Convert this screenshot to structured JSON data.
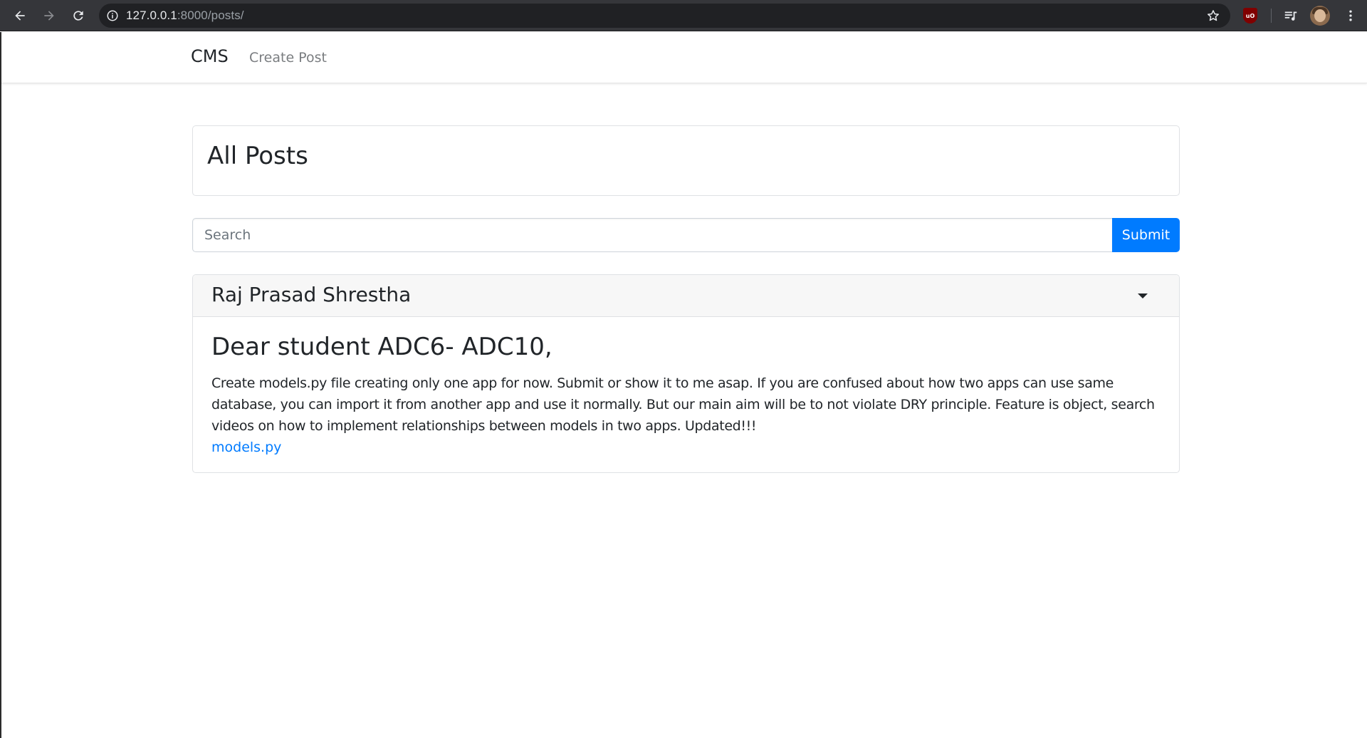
{
  "browser": {
    "url_host": "127.0.0.1",
    "url_path": ":8000/posts/",
    "icons": [
      "back-icon",
      "forward-icon",
      "reload-icon",
      "info-icon",
      "star-icon",
      "ublock-icon",
      "media-icon",
      "avatar",
      "menu-icon"
    ],
    "ublock_label": "uO"
  },
  "navbar": {
    "brand": "CMS",
    "links": [
      "Create Post"
    ]
  },
  "page": {
    "heading": "All Posts"
  },
  "search": {
    "placeholder": "Search",
    "value": "",
    "submit_label": "Submit"
  },
  "posts": [
    {
      "author": "Raj Prasad Shrestha",
      "title": "Dear student ADC6- ADC10,",
      "body": "Create models.py file creating only one app for now. Submit or show it to me asap. If you are confused about how two apps can use same database, you can import it from another app and use it normally. But our main aim will be to not violate DRY principle. Feature is object, search videos on how to implement relationships between models in two apps. Updated!!!",
      "attachment": "models.py"
    }
  ],
  "colors": {
    "primary": "#007bff",
    "chrome_bg": "#35363a",
    "omnibox_bg": "#202124",
    "card_header_bg": "#f7f7f7",
    "text": "#212529",
    "nav_link": "#7a7d80"
  }
}
